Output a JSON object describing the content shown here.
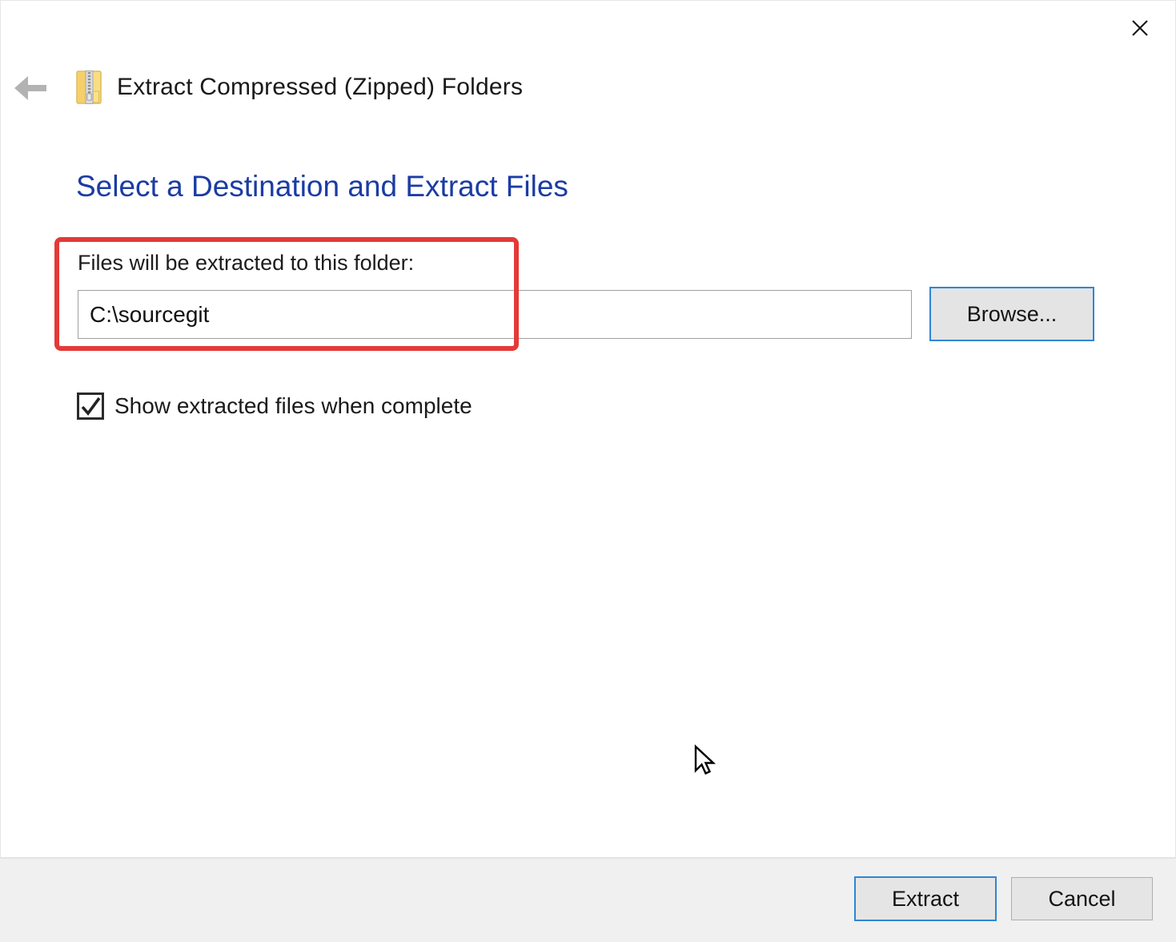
{
  "window": {
    "close_icon": "close-x"
  },
  "header": {
    "back_icon": "back-arrow",
    "icon": "zip-folder",
    "title": "Extract Compressed (Zipped) Folders"
  },
  "main": {
    "heading": "Select a Destination and Extract Files",
    "destination": {
      "label": "Files will be extracted to this folder:",
      "value": "C:\\sourcegit",
      "browse_label": "Browse..."
    },
    "show_files_checkbox": {
      "label": "Show extracted files when complete",
      "checked": true
    }
  },
  "footer": {
    "extract_label": "Extract",
    "cancel_label": "Cancel"
  },
  "annotation": {
    "type": "red-rectangle-highlight",
    "color": "#e33a38"
  },
  "colors": {
    "heading_blue": "#1b3ca4",
    "focus_border": "#2f87d4",
    "button_bg": "#e4e4e4",
    "button_border_gray": "#aeaeae",
    "footer_bg": "#f0f0f0",
    "back_arrow_gray": "#b3b3b3"
  }
}
